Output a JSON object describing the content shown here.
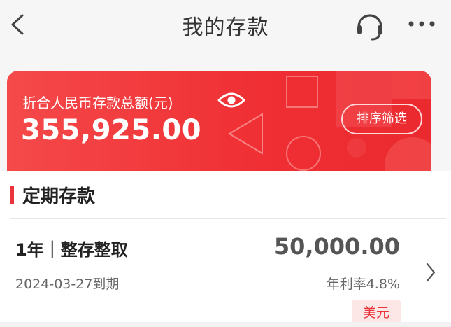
{
  "header": {
    "title": "我的存款",
    "back_icon": "chevron-left-icon",
    "support_icon": "headset-icon",
    "more_icon": "more-horizontal-icon"
  },
  "summary": {
    "label": "折合人民币存款总额(元)",
    "amount": "355,925.00",
    "eye_icon": "eye-icon",
    "sort_filter_label": "排序筛选"
  },
  "section": {
    "title": "定期存款"
  },
  "deposits": [
    {
      "term_type": "1年｜整存整取",
      "amount": "50,000.00",
      "maturity": "2024-03-27到期",
      "rate": "年利率4.8%",
      "currency": "美元"
    }
  ],
  "colors": {
    "brand_red": "#ef2f33",
    "accent_red": "#e8343a",
    "badge_bg": "#fde6e6"
  }
}
